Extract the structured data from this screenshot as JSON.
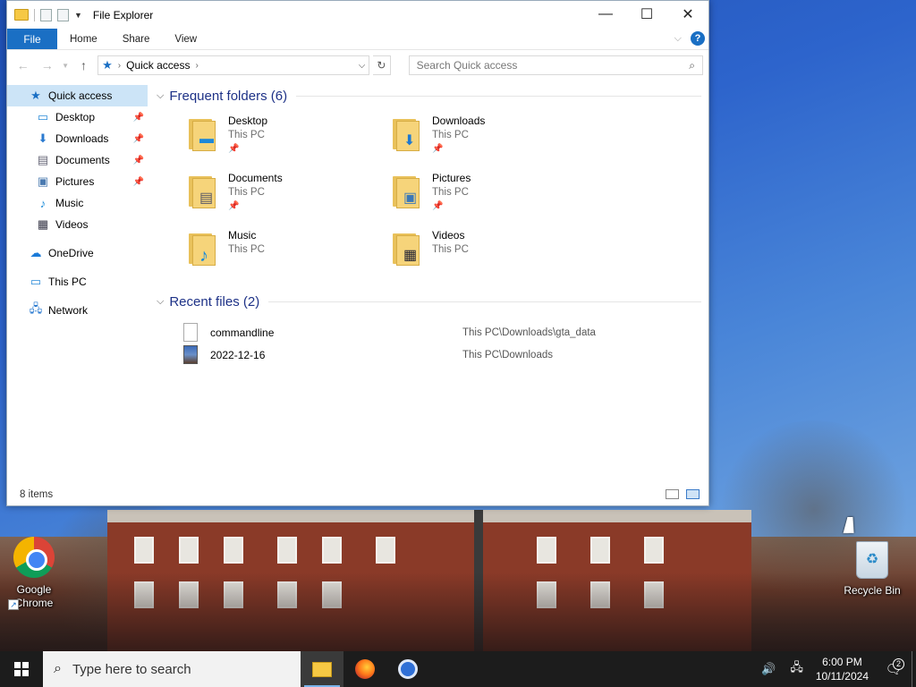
{
  "window": {
    "title": "File Explorer",
    "minimize_glyph": "—",
    "maximize_glyph": "☐",
    "close_glyph": "✕"
  },
  "ribbon": {
    "tabs": [
      "File",
      "Home",
      "Share",
      "View"
    ],
    "help_glyph": "?"
  },
  "address": {
    "location": "Quick access",
    "search_placeholder": "Search Quick access"
  },
  "nav": {
    "quick_access": "Quick access",
    "pinned": [
      {
        "label": "Desktop",
        "pinned": true
      },
      {
        "label": "Downloads",
        "pinned": true
      },
      {
        "label": "Documents",
        "pinned": true
      },
      {
        "label": "Pictures",
        "pinned": true
      },
      {
        "label": "Music",
        "pinned": false
      },
      {
        "label": "Videos",
        "pinned": false
      }
    ],
    "onedrive": "OneDrive",
    "this_pc": "This PC",
    "network": "Network"
  },
  "frequent": {
    "header": "Frequent folders (6)",
    "folders": [
      {
        "name": "Desktop",
        "location": "This PC",
        "pinned": true
      },
      {
        "name": "Downloads",
        "location": "This PC",
        "pinned": true
      },
      {
        "name": "Documents",
        "location": "This PC",
        "pinned": true
      },
      {
        "name": "Pictures",
        "location": "This PC",
        "pinned": true
      },
      {
        "name": "Music",
        "location": "This PC",
        "pinned": false
      },
      {
        "name": "Videos",
        "location": "This PC",
        "pinned": false
      }
    ]
  },
  "recent": {
    "header": "Recent files (2)",
    "files": [
      {
        "name": "commandline",
        "path": "This PC\\Downloads\\gta_data"
      },
      {
        "name": "2022-12-16",
        "path": "This PC\\Downloads"
      }
    ]
  },
  "status": {
    "item_count": "8 items"
  },
  "desktop": {
    "icons": [
      {
        "label": "Google Chrome"
      },
      {
        "label": "Recycle Bin"
      }
    ]
  },
  "taskbar": {
    "search_placeholder": "Type here to search",
    "time": "6:00 PM",
    "date": "10/11/2024",
    "notification_count": "2"
  }
}
